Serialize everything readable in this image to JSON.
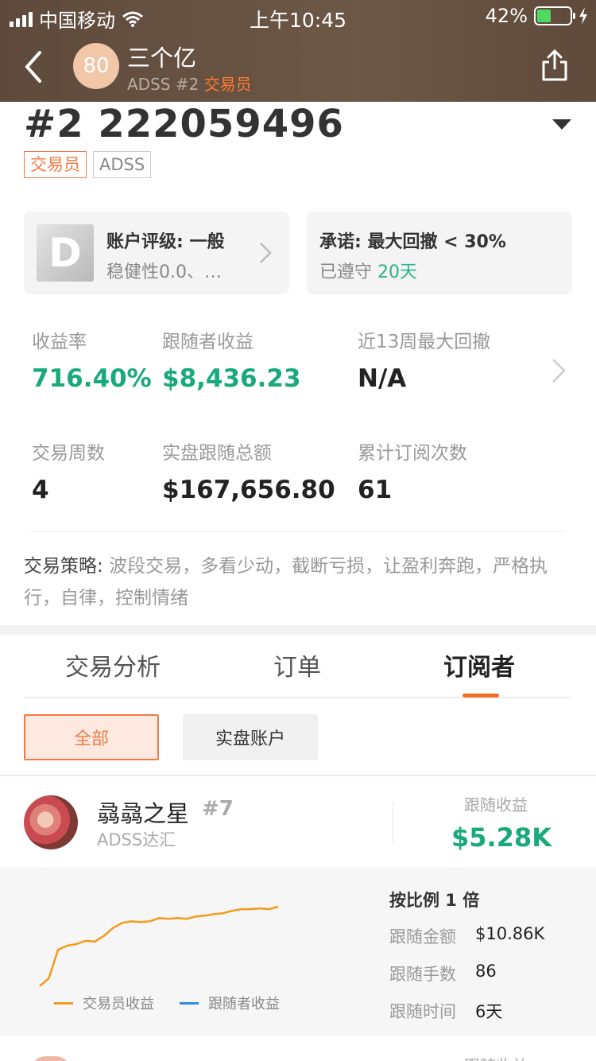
{
  "status_bar": {
    "carrier": "中国移动",
    "time": "上午10:45",
    "battery": "42%",
    "battery_level": 0.42
  },
  "header": {
    "avatar_text": "80",
    "name": "三个亿",
    "broker": "ADSS",
    "rank": "#2",
    "role": "交易员",
    "icons": {
      "back": "back-arrow-icon",
      "share": "share-icon"
    }
  },
  "account": {
    "title": "#2 222059496",
    "tags": [
      "交易员",
      "ADSS"
    ]
  },
  "rating_card": {
    "grade": "D",
    "title": "账户评级: 一般",
    "sub": "稳健性0.0、…"
  },
  "promise_card": {
    "title": "承诺: 最大回撤 < 30%",
    "sub_prefix": "已遵守",
    "days": "20天"
  },
  "stats": [
    {
      "label": "收益率",
      "value": "716.40%"
    },
    {
      "label": "跟随者收益",
      "value": "$8,436.23"
    },
    {
      "label": "近13周最大回撤",
      "value": "N/A"
    },
    {
      "label": "交易周数",
      "value": "4"
    },
    {
      "label": "实盘跟随总额",
      "value": "$167,656.80"
    },
    {
      "label": "累计订阅次数",
      "value": "61"
    }
  ],
  "strategy": {
    "key": "交易策略:",
    "text": "波段交易，多看少动，截断亏损，让盈利奔跑，严格执行，自律，控制情绪"
  },
  "tabs": [
    "交易分析",
    "订单",
    "订阅者"
  ],
  "active_tab": 2,
  "filters": [
    "全部",
    "实盘账户"
  ],
  "subscriber": {
    "name": "骉骉之星",
    "rank": "#7",
    "broker": "ADSS达汇",
    "earn_label": "跟随收益",
    "earn_value": "$5.28K",
    "ratio": "按比例 1 倍",
    "details": [
      {
        "label": "跟随金额",
        "value": "$10.86K"
      },
      {
        "label": "跟随手数",
        "value": "86"
      },
      {
        "label": "跟随时间",
        "value": "6天"
      }
    ],
    "legend": [
      {
        "name": "交易员收益",
        "color": "#f39a1c"
      },
      {
        "name": "跟随者收益",
        "color": "#2d8ee5"
      }
    ]
  },
  "next_item": {
    "earn_label": "跟随收益"
  },
  "colors": {
    "accent": "#f26b22",
    "green": "#19a97b",
    "header_bg": "#6d5746"
  },
  "chart_data": {
    "type": "line",
    "series": [
      {
        "name": "交易员收益",
        "values": [
          0,
          0.1,
          0.45,
          0.5,
          0.52,
          0.56,
          0.55,
          0.62,
          0.72,
          0.78,
          0.8,
          0.79,
          0.8,
          0.84,
          0.83,
          0.84,
          0.83,
          0.86,
          0.87,
          0.89,
          0.9,
          0.93,
          0.95,
          0.95,
          0.96,
          0.95,
          0.98
        ]
      },
      {
        "name": "跟随者收益",
        "values": []
      }
    ]
  }
}
